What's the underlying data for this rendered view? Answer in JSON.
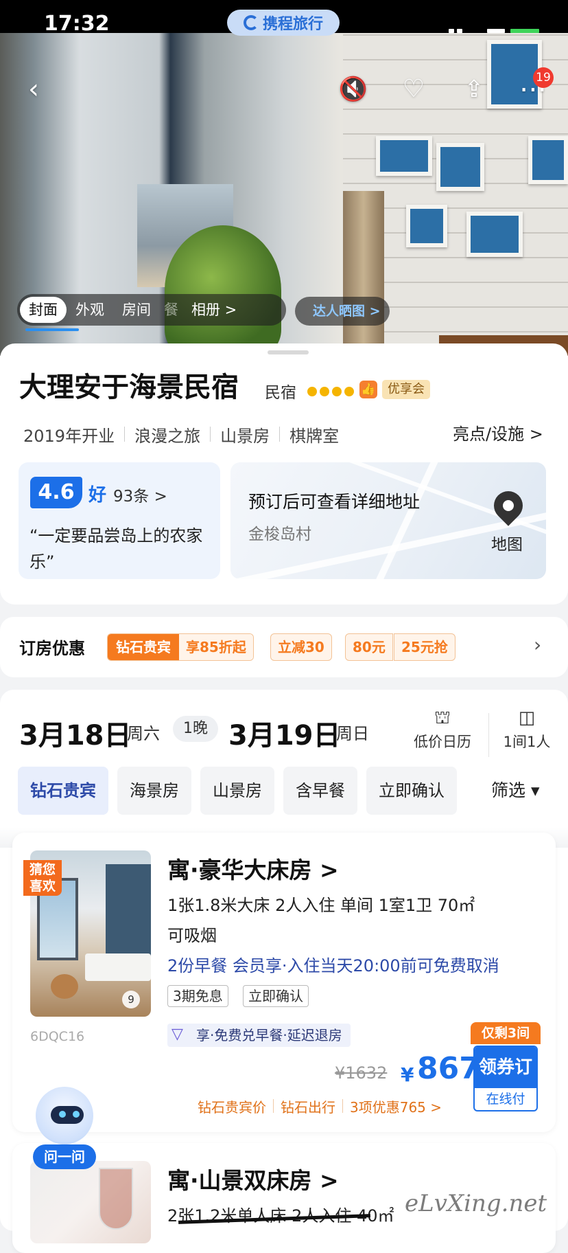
{
  "status_bar": {
    "time": "17:32"
  },
  "brand": {
    "name": "携程旅行"
  },
  "hero": {
    "back_icon": "chevron-left-icon",
    "notification_count": "19",
    "gallery_tabs": [
      "封面",
      "外观",
      "房间",
      "餐",
      "相册 >"
    ],
    "talent_button": "达人晒图 >"
  },
  "hotel": {
    "name": "大理安于海景民宿",
    "type": "民宿",
    "stars": 4,
    "member_tag": "优享会",
    "tags": [
      "2019年开业",
      "浪漫之旅",
      "山景房",
      "棋牌室"
    ],
    "facilities_link": "亮点/设施 >",
    "score": "4.6",
    "score_label": "好",
    "review_count": "93条 >",
    "review_quote": "“一定要品尝岛上的农家乐”",
    "address_hint": "预订后可查看详细地址",
    "address_area": "金梭岛村",
    "map_label": "地图"
  },
  "promo": {
    "title": "订房优惠",
    "diamond_label": "钻石贵宾",
    "diamond_discount": "享85折起",
    "tags": [
      "立减30",
      "80元",
      "25元抢"
    ],
    "arrow": "›"
  },
  "booking": {
    "checkin_date": "3月18日",
    "checkin_weekday": "周六",
    "nights": "1晚",
    "checkout_date": "3月19日",
    "checkout_weekday": "周日",
    "calendar_label": "低价日历",
    "guests_label": "1间1人",
    "filters": [
      "钻石贵宾",
      "海景房",
      "山景房",
      "含早餐",
      "立即确认"
    ],
    "screen_label": "筛选 ▾"
  },
  "rooms": [
    {
      "title": "寓·豪华大床房 >",
      "guess_tag": "猜您喜欢",
      "image_count": "9",
      "code": "6DQC16",
      "specs": "1张1.8米大床  2人入住  单间  1室1卫  70㎡",
      "smoking": "可吸烟",
      "breakfast_policy": "2份早餐  会员享·入住当天20:00前可免费取消",
      "tags": [
        "3期免息",
        "立即确认"
      ],
      "benefit": "享·免费兑早餐·延迟退房",
      "original_price": "¥1632",
      "currency": "¥",
      "price": "867",
      "price_tags": [
        "钻石贵宾价",
        "钻石出行",
        "3项优惠765 >"
      ],
      "stock_tag": "仅剩3间",
      "book_label": "领券订",
      "pay_label": "在线付"
    },
    {
      "title": "寓·山景双床房 >",
      "specs": "2张1.2米单人床  2人入住  40㎡"
    }
  ],
  "assistant": {
    "ask_label": "问一问"
  },
  "watermark": "eLvXing.net",
  "colors": {
    "brand_blue": "#1c6fe8",
    "promo_orange": "#f57a1f",
    "star_gold": "#f5b400"
  }
}
